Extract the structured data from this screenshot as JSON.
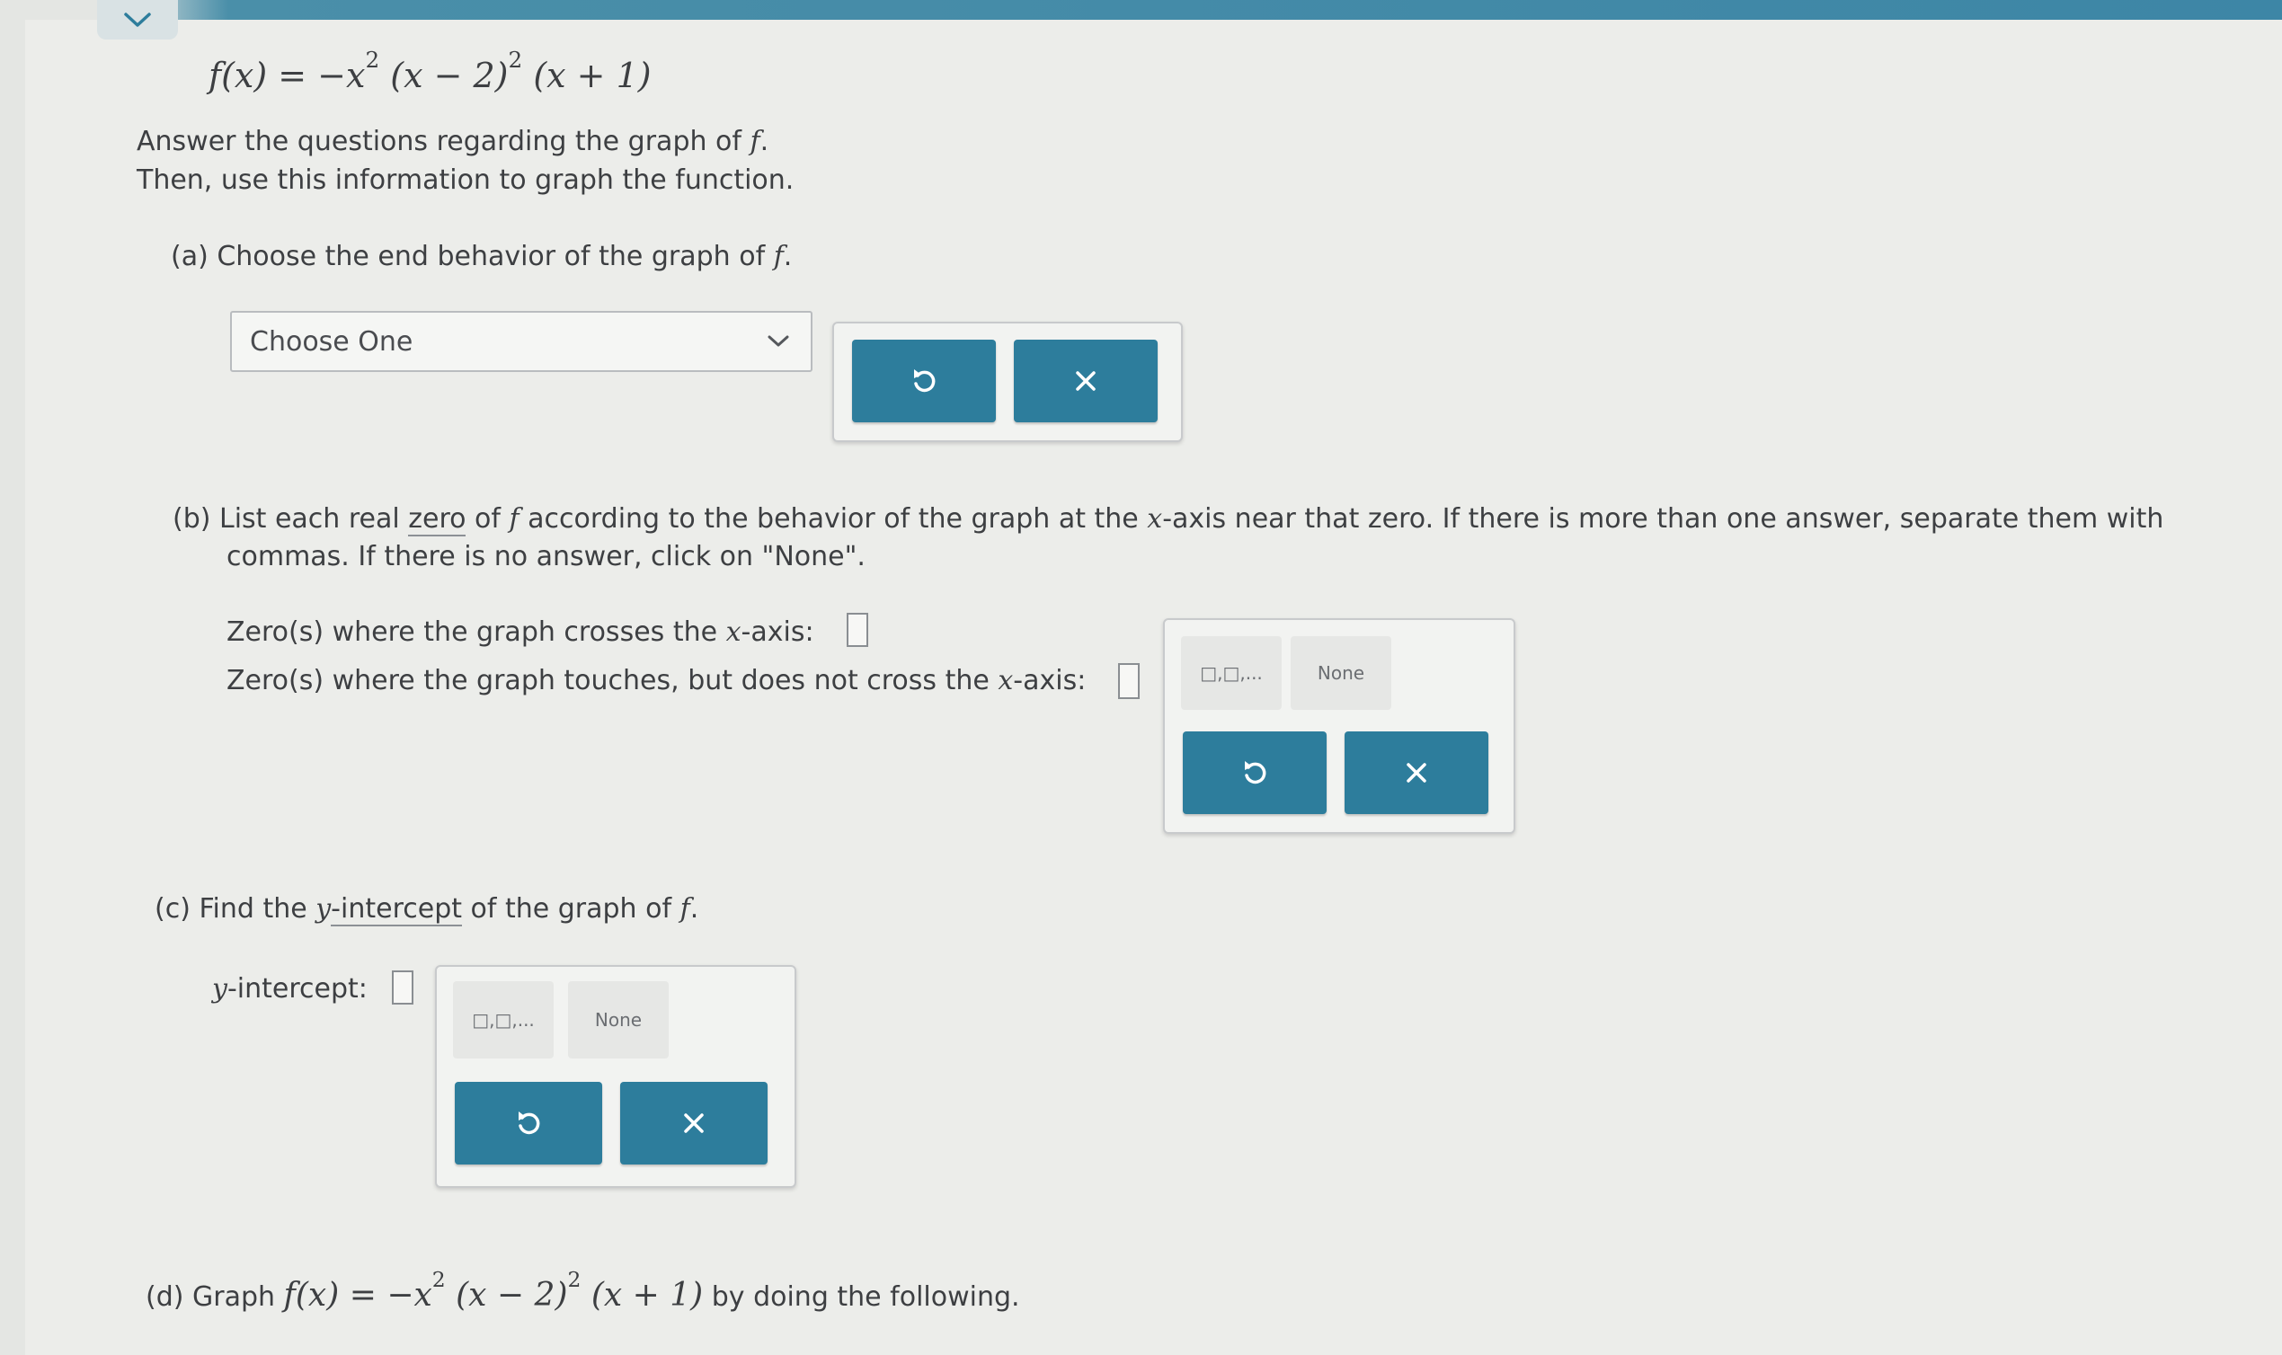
{
  "formula": {
    "lhs": "f(x) = ",
    "t1": "−x",
    "exp1": "2",
    "t2": "(x − 2)",
    "exp2": "2",
    "t3": "(x + 1)"
  },
  "intro": {
    "line1_prefix": "Answer the questions regarding the graph of ",
    "line1_var": "f",
    "line1_suffix": ".",
    "line2": "Then, use this information to graph the function."
  },
  "part_a": {
    "label": "(a)  Choose the end behavior of the graph of ",
    "var": "f",
    "suffix": ".",
    "select_value": "Choose One"
  },
  "part_b": {
    "label_pre": "(b)  List each real ",
    "zero_link": "zero",
    "label_mid": " of ",
    "var": "f",
    "label_mid2": " according to the behavior of the graph at the ",
    "xvar": "x",
    "label_post": "-axis near that zero. If there is more than one answer, separate them with",
    "line2": "commas. If there is no answer, click on \"None\".",
    "crosses_pre": "Zero(s) where the graph crosses the ",
    "crosses_x": "x",
    "crosses_post": "-axis:",
    "touches_pre": "Zero(s) where the graph touches, but does not cross the ",
    "touches_x": "x",
    "touches_post": "-axis:",
    "list_chip": "□,□,...",
    "none_chip": "None"
  },
  "part_c": {
    "label_pre": "(c)  Find the ",
    "yvar": "y",
    "link": "-intercept",
    "label_mid": " of the graph of ",
    "var": "f",
    "suffix": ".",
    "field_y": "y",
    "field_label": "-intercept:",
    "list_chip": "□,□,...",
    "none_chip": "None"
  },
  "part_d": {
    "label": "(d)  Graph ",
    "suffix": " by doing the following."
  },
  "colors": {
    "button": "#2d7d9c",
    "topbar": "#3d86a6"
  },
  "icons": {
    "undo": "undo-icon",
    "clear": "close-icon",
    "collapse": "chevron-down-icon"
  }
}
